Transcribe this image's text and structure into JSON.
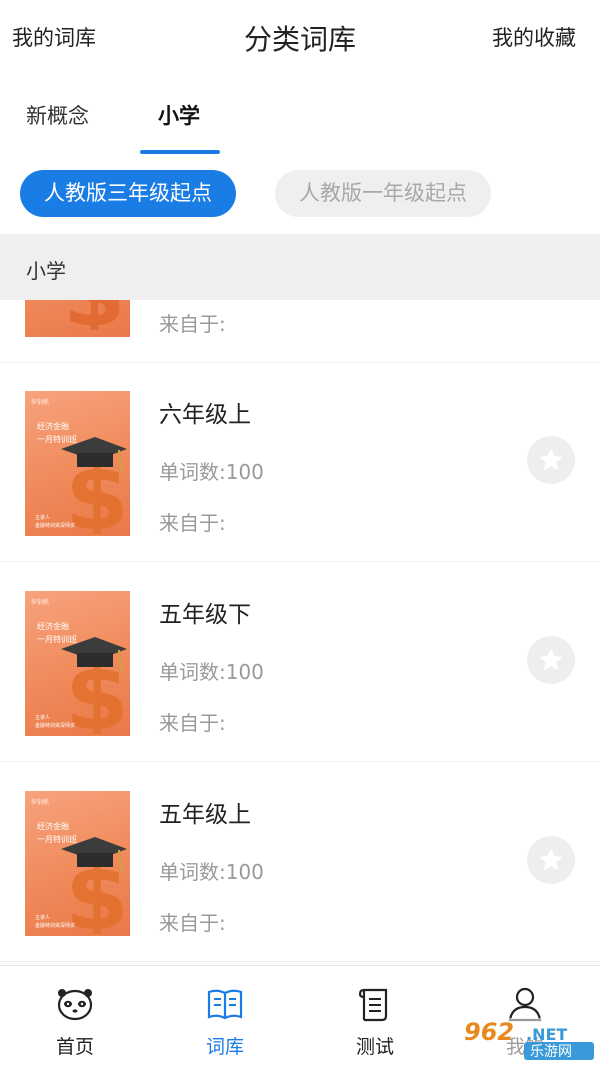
{
  "header": {
    "left": "我的词库",
    "title": "分类词库",
    "right": "我的收藏"
  },
  "tabs": [
    {
      "label": "新概念"
    },
    {
      "label": "小学"
    }
  ],
  "chips": [
    {
      "label": "人教版三年级起点"
    },
    {
      "label": "人教版一年级起点"
    }
  ],
  "section": {
    "title": "小学"
  },
  "cover": {
    "tag": "华训练",
    "line1": "经济金融",
    "line2": "一月特训班",
    "line3": "主讲人",
    "line4": "金融特训资深师资"
  },
  "books": [
    {
      "name": "",
      "count": "",
      "source": "来自于:"
    },
    {
      "name": "六年级上",
      "count": "单词数:100",
      "source": "来自于:"
    },
    {
      "name": "五年级下",
      "count": "单词数:100",
      "source": "来自于:"
    },
    {
      "name": "五年级上",
      "count": "单词数:100",
      "source": "来自于:"
    }
  ],
  "bottom_nav": [
    {
      "label": "首页",
      "icon": "panda-icon"
    },
    {
      "label": "词库",
      "icon": "book-icon"
    },
    {
      "label": "测试",
      "icon": "scroll-icon"
    },
    {
      "label": "我的",
      "icon": "user-icon"
    }
  ],
  "watermark": {
    "brand": "962",
    "suffix": ".NET",
    "site": "乐游网"
  },
  "colors": {
    "accent": "#1a7de6",
    "muted": "#999999",
    "section_bg": "#efefef",
    "cover": "#f08a5b"
  }
}
